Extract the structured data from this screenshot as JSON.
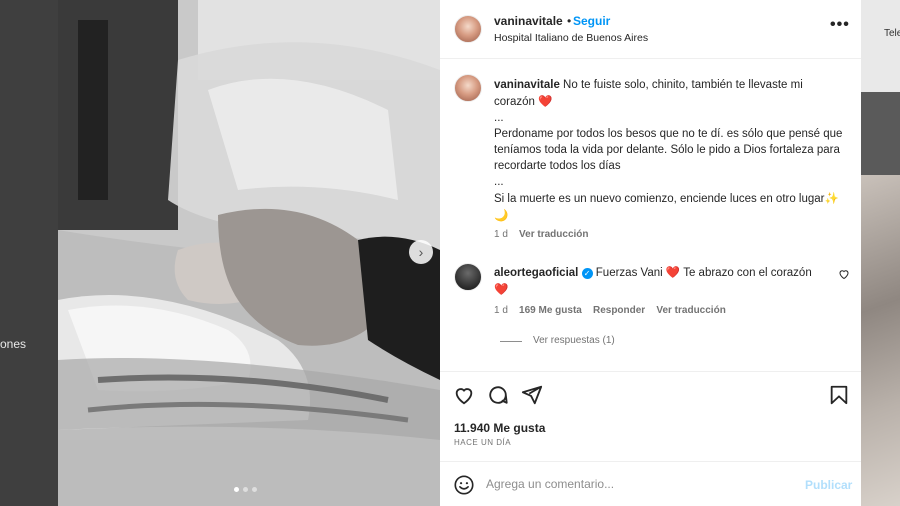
{
  "background": {
    "left_text": "ones",
    "right_text": "Tele"
  },
  "post": {
    "header": {
      "username": "vaninavitale",
      "separator": "•",
      "follow_label": "Seguir",
      "location": "Hospital Italiano de Buenos Aires",
      "more_label": "•••"
    },
    "caption": {
      "username": "vaninavitale",
      "line1": "No te fuiste solo, chinito, también te llevaste mi corazón",
      "emoji1": "❤️",
      "ellipsis1": "...",
      "line2": "Perdoname por todos los besos que no te dí. es sólo que pensé que teníamos toda la vida por delante. Sólo le pido a Dios fortaleza para recordarte todos los días",
      "ellipsis2": "...",
      "line3": "Si la muerte es un nuevo comienzo, enciende luces en otro lugar",
      "emoji3": "✨🌙",
      "time": "1 d",
      "translate": "Ver traducción"
    },
    "comment": {
      "username": "aleortegaoficial",
      "verified": "✓",
      "text1": "Fuerzas Vani",
      "emoji1": "❤️",
      "text2": "Te abrazo con el corazón",
      "emoji2": "❤️",
      "time": "1 d",
      "likes": "169 Me gusta",
      "reply": "Responder",
      "translate": "Ver traducción",
      "view_replies": "Ver respuestas (1)"
    },
    "likes": "11.940 Me gusta",
    "ago": "HACE UN DÍA",
    "add_comment": {
      "placeholder": "Agrega un comentario...",
      "publish": "Publicar"
    },
    "carousel": {
      "next_icon": "›",
      "total_slides": 3,
      "active_slide": 1
    }
  },
  "colors": {
    "link_blue": "#0095f6",
    "publish_disabled": "#b2dffc",
    "heart_red": "#ed4956",
    "muted": "#737373"
  },
  "icons": [
    "heart-icon",
    "comment-icon",
    "share-icon",
    "bookmark-icon",
    "emoji-icon",
    "more-icon",
    "chevron-right-icon"
  ]
}
